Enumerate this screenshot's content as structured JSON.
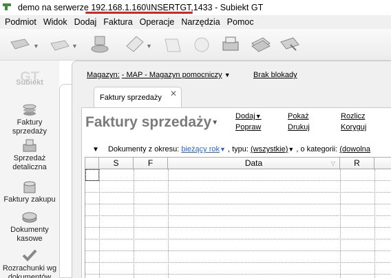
{
  "window": {
    "title_prefix": "demo na serwerze ",
    "title_server": "192.168.1.160\\INSERTGT,1433",
    "title_suffix": " - Subiekt GT"
  },
  "menu": [
    "Podmiot",
    "Widok",
    "Dodaj",
    "Faktura",
    "Operacje",
    "Narzędzia",
    "Pomoc"
  ],
  "leftnav": {
    "brand": "Subiekt",
    "items": [
      {
        "label": "Faktury sprzedaży",
        "icon": "coins-stack-icon"
      },
      {
        "label": "Sprzedaż detaliczna",
        "icon": "cash-register-icon"
      },
      {
        "label": "Faktury zakupu",
        "icon": "coins-stack-icon"
      },
      {
        "label": "Dokumenty kasowe",
        "icon": "coins-icon"
      },
      {
        "label": "Rozrachunki wg dokumentów",
        "icon": "checkmark-icon"
      }
    ]
  },
  "header": {
    "magazyn_label": "Magazyn:",
    "magazyn_value": "- MAP - Magazyn pomocniczy",
    "blokady": "Brak blokady"
  },
  "tab": {
    "label": "Faktury sprzedaży"
  },
  "page": {
    "title": "Faktury sprzedaży",
    "actions": {
      "dodaj": "Dodaj",
      "popraw": "Popraw",
      "pokaz": "Pokaż",
      "drukuj": "Drukuj",
      "rozlicz": "Rozlicz",
      "koryguj": "Koryguj"
    }
  },
  "filter": {
    "label": "Dokumenty z okresu:",
    "period": "bieżący rok",
    "typ_label": ", typu:",
    "typ_value": "(wszystkie)",
    "kat_label": ", o kategorii:",
    "kat_value": "(dowolna"
  },
  "grid": {
    "columns": [
      "",
      "S",
      "F",
      "Data",
      "R",
      ""
    ]
  }
}
